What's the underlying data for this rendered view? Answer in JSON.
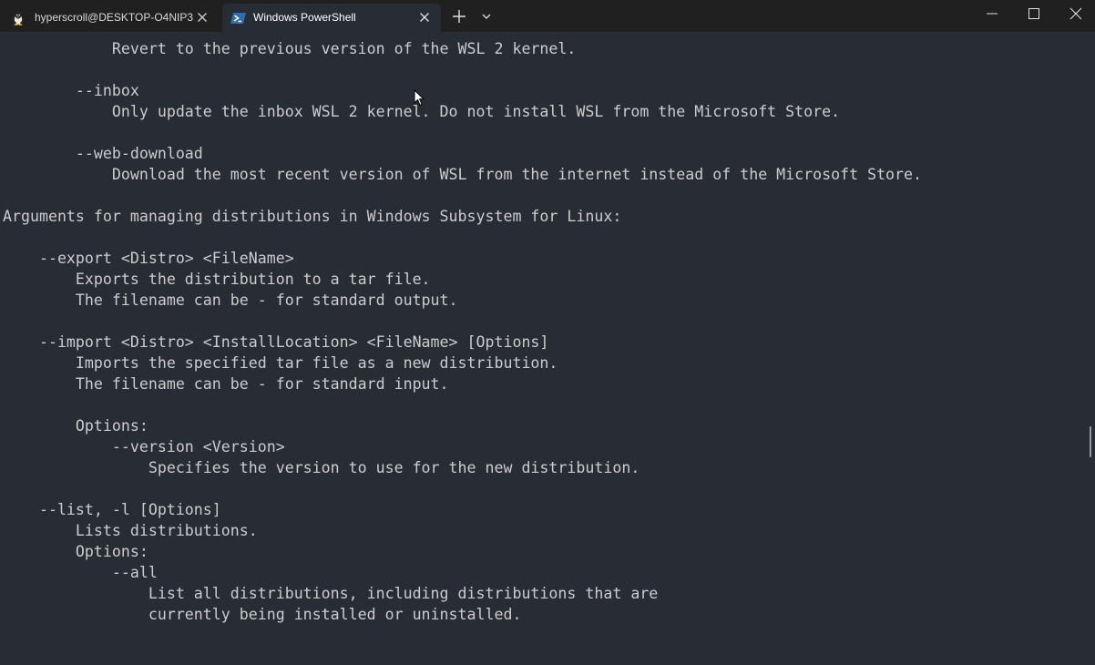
{
  "tabs": [
    {
      "title": "hyperscroll@DESKTOP-O4NIP3",
      "icon": "linux-penguin-icon",
      "active": false
    },
    {
      "title": "Windows PowerShell",
      "icon": "powershell-icon",
      "active": true
    }
  ],
  "colors": {
    "titlebar": "#202020",
    "terminal_bg": "#282c34",
    "terminal_fg": "#cccccc"
  },
  "terminal": {
    "lines": [
      "            Revert to the previous version of the WSL 2 kernel.",
      "",
      "        --inbox",
      "            Only update the inbox WSL 2 kernel. Do not install WSL from the Microsoft Store.",
      "",
      "        --web-download",
      "            Download the most recent version of WSL from the internet instead of the Microsoft Store.",
      "",
      "Arguments for managing distributions in Windows Subsystem for Linux:",
      "",
      "    --export <Distro> <FileName>",
      "        Exports the distribution to a tar file.",
      "        The filename can be - for standard output.",
      "",
      "    --import <Distro> <InstallLocation> <FileName> [Options]",
      "        Imports the specified tar file as a new distribution.",
      "        The filename can be - for standard input.",
      "",
      "        Options:",
      "            --version <Version>",
      "                Specifies the version to use for the new distribution.",
      "",
      "    --list, -l [Options]",
      "        Lists distributions.",
      "        Options:",
      "            --all",
      "                List all distributions, including distributions that are",
      "                currently being installed or uninstalled."
    ]
  }
}
